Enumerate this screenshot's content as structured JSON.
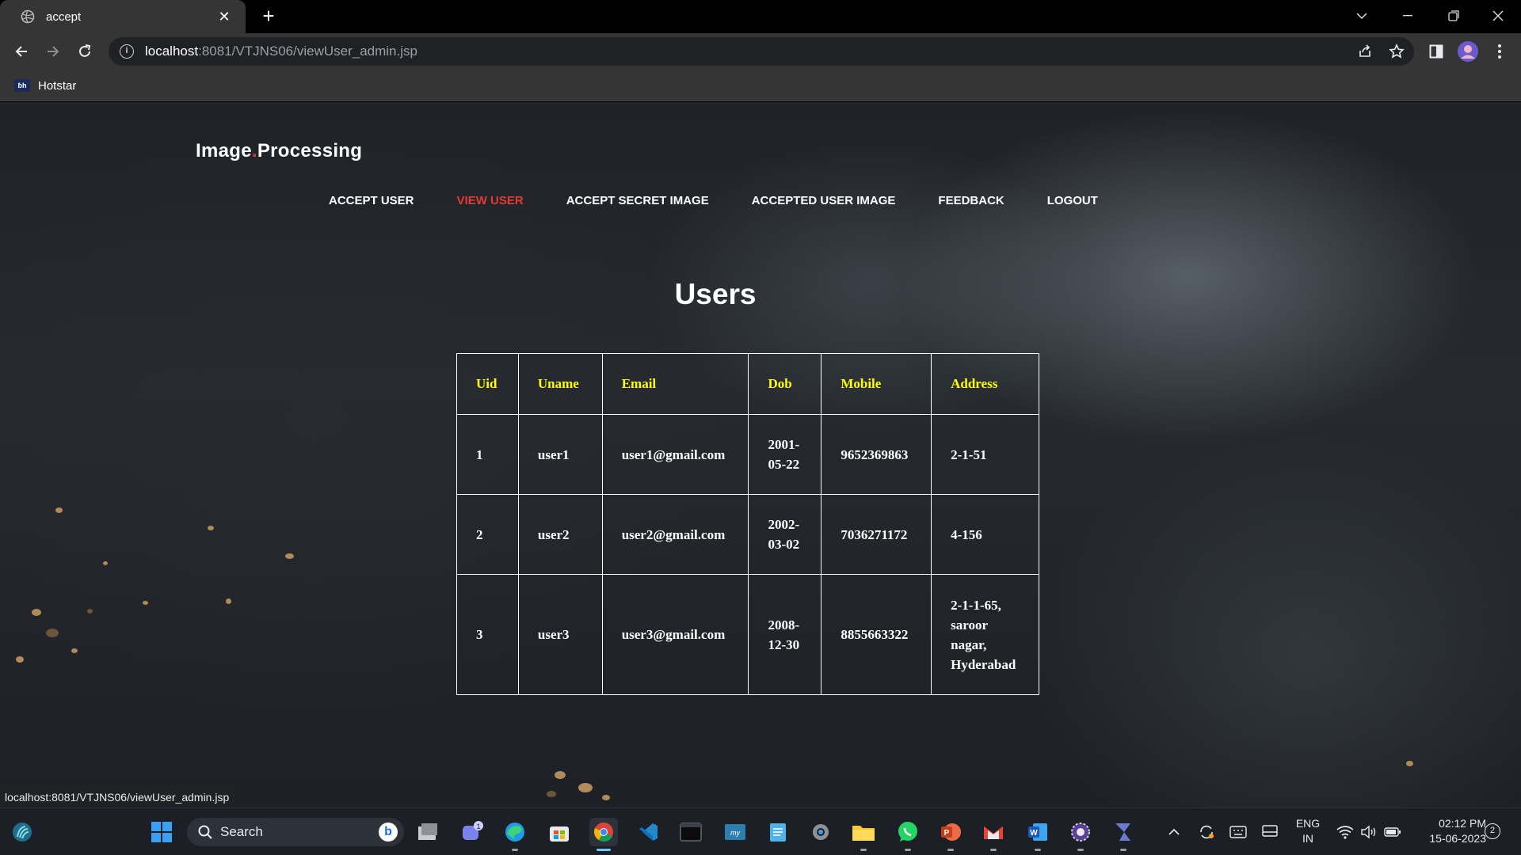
{
  "browser": {
    "tab_title": "accept",
    "url_host": "localhost",
    "url_path": ":8081/VTJNS06/viewUser_admin.jsp",
    "status_url": "localhost:8081/VTJNS06/viewUser_admin.jsp",
    "bookmarks": [
      {
        "label": "Hotstar",
        "icon": "hotstar-icon",
        "icon_text": "ɓh"
      }
    ]
  },
  "site": {
    "title_part1": "Image",
    "title_dot": ".",
    "title_part2": "Processing",
    "accent_color": "#e53935",
    "nav": [
      {
        "label": "ACCEPT USER",
        "active": false
      },
      {
        "label": "VIEW USER",
        "active": true
      },
      {
        "label": "ACCEPT SECRET IMAGE",
        "active": false
      },
      {
        "label": "ACCEPTED USER IMAGE",
        "active": false
      },
      {
        "label": "FEEDBACK",
        "active": false
      },
      {
        "label": "LOGOUT",
        "active": false
      }
    ],
    "heading": "Users"
  },
  "table": {
    "header_color": "#ffff00",
    "columns": [
      "Uid",
      "Uname",
      "Email",
      "Dob",
      "Mobile",
      "Address"
    ],
    "rows": [
      {
        "uid": "1",
        "uname": "user1",
        "email": "user1@gmail.com",
        "dob": "2001-05-22",
        "mobile": "9652369863",
        "address": "2-1-51"
      },
      {
        "uid": "2",
        "uname": "user2",
        "email": "user2@gmail.com",
        "dob": "2002-03-02",
        "mobile": "7036271172",
        "address": "4-156"
      },
      {
        "uid": "3",
        "uname": "user3",
        "email": "user3@gmail.com",
        "dob": "2008-12-30",
        "mobile": "8855663322",
        "address": "2-1-1-65, saroor nagar, Hyderabad"
      }
    ]
  },
  "taskbar": {
    "search_placeholder": "Search",
    "bing_letter": "b",
    "chat_badge": "1",
    "apps": [
      "windows-start-icon",
      "task-view-icon",
      "teams-chat-icon",
      "edge-icon",
      "microsoft-store-icon",
      "chrome-icon",
      "vscode-icon",
      "terminal-icon",
      "mysql-icon",
      "notepad-icon",
      "settings-icon",
      "file-explorer-icon",
      "whatsapp-icon",
      "powerpoint-icon",
      "gmail-icon",
      "word-icon",
      "eclipse-icon",
      "netbeans-icon"
    ],
    "lang_line1": "ENG",
    "lang_line2": "IN",
    "time": "02:12 PM",
    "date": "15-06-2023",
    "notifications": "2"
  }
}
